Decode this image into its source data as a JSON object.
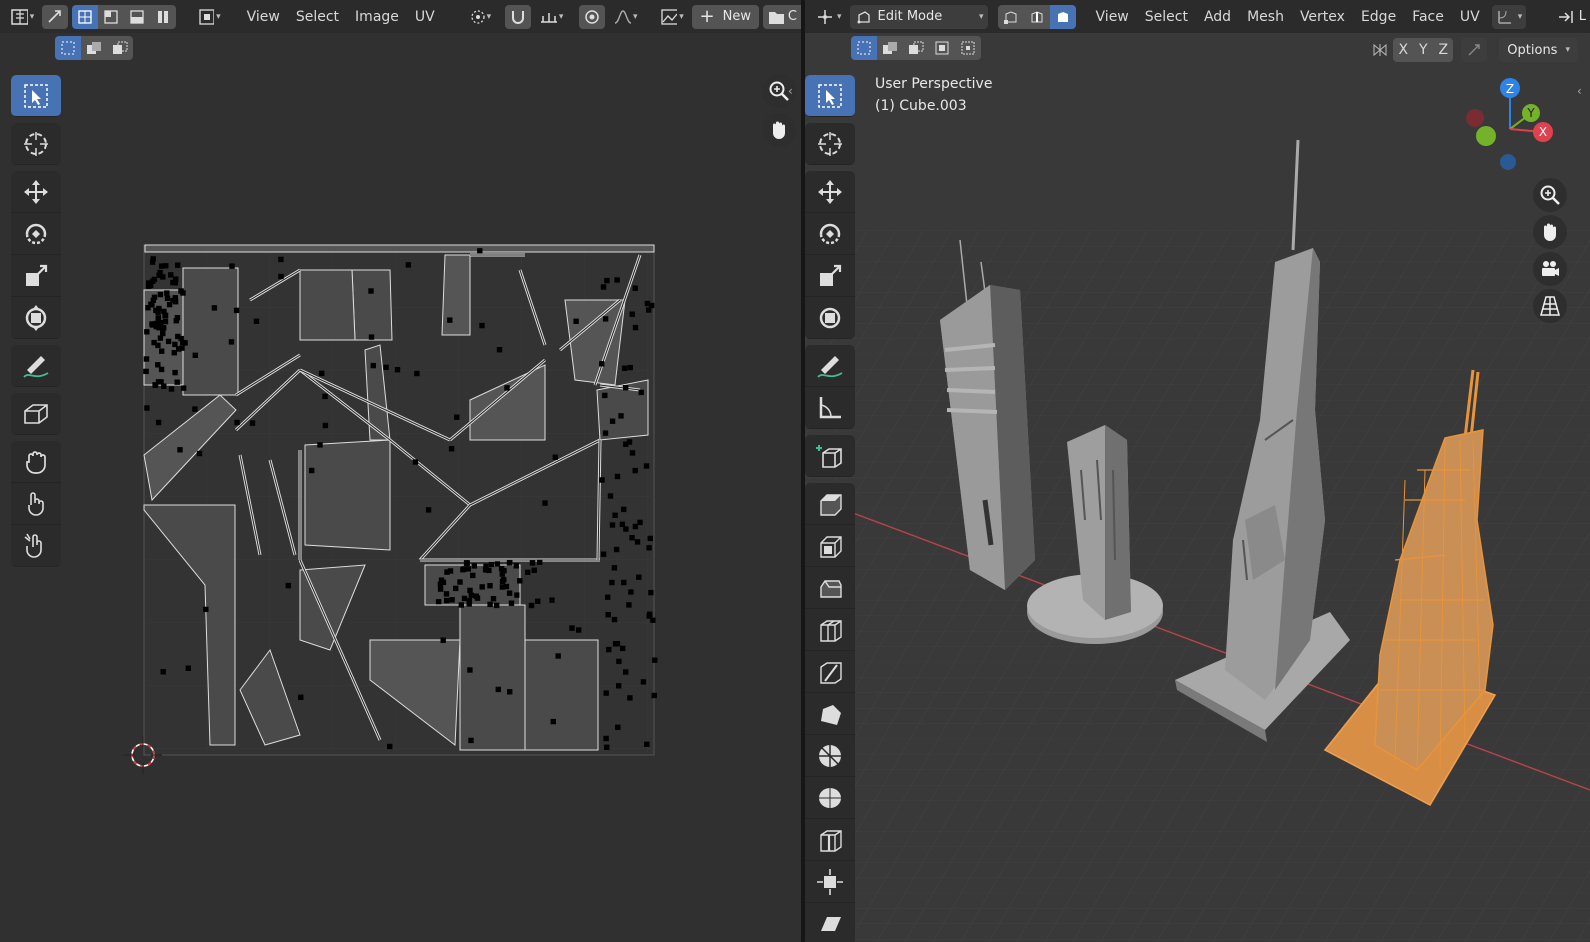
{
  "uv_editor": {
    "header": {
      "menus": [
        "View",
        "Select",
        "Image",
        "UV"
      ],
      "new_label": "New",
      "cut_label": "C"
    },
    "tools": [
      "select-box",
      "cursor",
      "move",
      "rotate",
      "scale",
      "transform",
      "annotate",
      "rip-region",
      "grab",
      "relax",
      "pinch"
    ],
    "nav": [
      "zoom-icon",
      "hand-icon"
    ]
  },
  "viewport": {
    "header": {
      "mode": "Edit Mode",
      "menus": [
        "View",
        "Select",
        "Add",
        "Mesh",
        "Vertex",
        "Edge",
        "Face",
        "UV"
      ],
      "axes": [
        "X",
        "Y",
        "Z"
      ],
      "options_label": "Options",
      "trailing_label": "L"
    },
    "overlay": {
      "perspective": "User Perspective",
      "object": "(1) Cube.003"
    },
    "gizmo": {
      "z": "Z",
      "y": "Y",
      "x": "X"
    },
    "colors": {
      "selection_orange": "#e8943a",
      "x_axis": "#e0414f",
      "y_axis": "#74b229",
      "z_axis": "#2e83e6",
      "accent_blue": "#4772b3"
    }
  }
}
